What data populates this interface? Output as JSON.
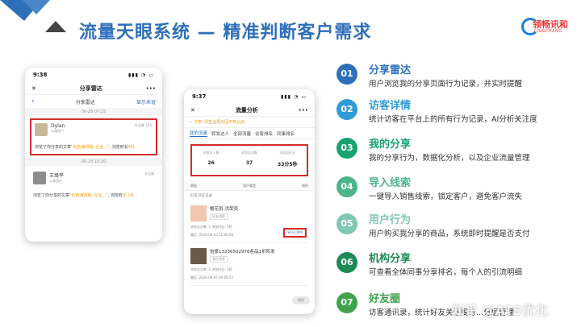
{
  "title": "流量天眼系统 — 精准判断客户需求",
  "logo": {
    "text": "领畅讯和",
    "sub": "LINGCHANG"
  },
  "phone1": {
    "time": "9:38",
    "app_title": "分享雷达",
    "sub_title": "分享雷达",
    "sub_link": "显示来谊",
    "date1": "06-28 07:25",
    "card1": {
      "name": "Dylan",
      "sub": "公域用户",
      "meta": "东北最 10%",
      "msg_a": "浏览了你分享的文章",
      "msg_link": "\"出自演讲稿, 企业...\"",
      "msg_b": ", 浏览时长",
      "msg_dur": "4秒"
    },
    "date2": "06-28 19:20",
    "card2": {
      "name": "王焕平",
      "sub": "公域用户",
      "meta": "东北最",
      "msg_a": "浏览了你分享的文章",
      "msg_link": "\"出自演讲稿, 企业...\"",
      "msg_b": ", 浏览时",
      "msg_dur": "长 1秒"
    }
  },
  "phone2": {
    "time": "9:37",
    "app_title": "流量分析",
    "crumb": "文章: 零售业再也回不到从前",
    "tabs": [
      "我的流量",
      "转发达人",
      "全部流量",
      "访客排名",
      "同事排名"
    ],
    "stats": [
      {
        "label": "浏览总人数",
        "value": "26"
      },
      {
        "label": "浏览总次数",
        "value": "37"
      },
      {
        "label": "浏览总时长",
        "value": "33分5秒"
      }
    ],
    "filter": [
      "筛选",
      "用户类型",
      "排序"
    ],
    "section": "好友浏览记录",
    "v1": {
      "name": "樱花雨-洪荣奕",
      "tag": "好友线索",
      "line1": "浏览总次数: 1 浏览时长: 3秒",
      "line2": "最近: 2020-06-03 15:09:58",
      "crm": "导入CRM"
    },
    "v2": {
      "name": "怡景13236502976各品1折转发",
      "tag": "潜在线索",
      "line1": "浏览总次数: 1 浏览时长: 3秒",
      "line2": "最近: 2020-06-05 09:08:52"
    },
    "fab": "首页"
  },
  "features": [
    {
      "num": "01",
      "title": "分享雷达",
      "desc": "用户浏览我的分享页面行为记录，并实时提醒",
      "color": "#2f6fba"
    },
    {
      "num": "02",
      "title": "访客详情",
      "desc": "统计访客在平台上的所有行为记录，AI分析关注度",
      "color": "#2f9bd8"
    },
    {
      "num": "03",
      "title": "我的分享",
      "desc": "我的分享行为，数据化分析，以及企业流量管理",
      "color": "#1aa36f"
    },
    {
      "num": "04",
      "title": "导入线索",
      "desc": "一键导入销售线索，锁定客户，避免客户流失",
      "color": "#4cb58a"
    },
    {
      "num": "05",
      "title": "用户行为",
      "desc": "用户购买我分享的商品，系统即时提醒是否支付",
      "color": "#7ec8b4"
    },
    {
      "num": "06",
      "title": "机构分享",
      "desc": "可查看全体同事分享排名，每个人的引流明细",
      "color": "#1e8a56"
    },
    {
      "num": "07",
      "title": "好友圈",
      "desc": "访客通讯录，统计好友关注度分...分层管理",
      "color": "#3fa34d"
    }
  ],
  "watermark": "知乎 @ATS优化"
}
